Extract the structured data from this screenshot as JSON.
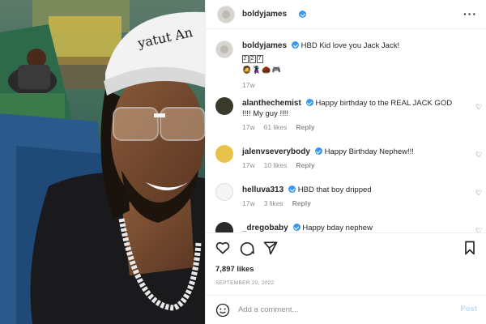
{
  "post": {
    "username": "boldyjames",
    "more_icon": "more-horizontal-icon"
  },
  "caption": {
    "username": "boldyjames",
    "text": "HBD Kid love you Jack Jack!",
    "number_boxes": [
      "2",
      "2",
      "7"
    ],
    "emoji_line": "🧔🦹🏿‍♂️🌰🎮",
    "age": "17w"
  },
  "comments": [
    {
      "username": "alanthechemist",
      "verified": true,
      "text": "Happy birthday to the REAL JACK GOD !!!! My guy !!!!",
      "age": "17w",
      "likes": "61 likes",
      "reply": "Reply"
    },
    {
      "username": "jalenvseverybody",
      "verified": true,
      "text": "Happy Birthday Nephew!!!",
      "age": "17w",
      "likes": "10 likes",
      "reply": "Reply"
    },
    {
      "username": "helluva313",
      "verified": true,
      "text": "HBD that boy dripped",
      "age": "17w",
      "likes": "3 likes",
      "reply": "Reply"
    },
    {
      "username": "_dregobaby",
      "verified": true,
      "text": "Happy bday nephew",
      "age": "",
      "likes": "",
      "reply": ""
    }
  ],
  "engagement": {
    "likes": "7,897 likes",
    "date": "SEPTEMBER 20, 2022"
  },
  "add_comment": {
    "placeholder": "Add a comment...",
    "post_label": "Post"
  },
  "colors": {
    "verified": "#3897f0",
    "muted": "#8e8e8e",
    "post_button_disabled": "#b2dffc"
  }
}
